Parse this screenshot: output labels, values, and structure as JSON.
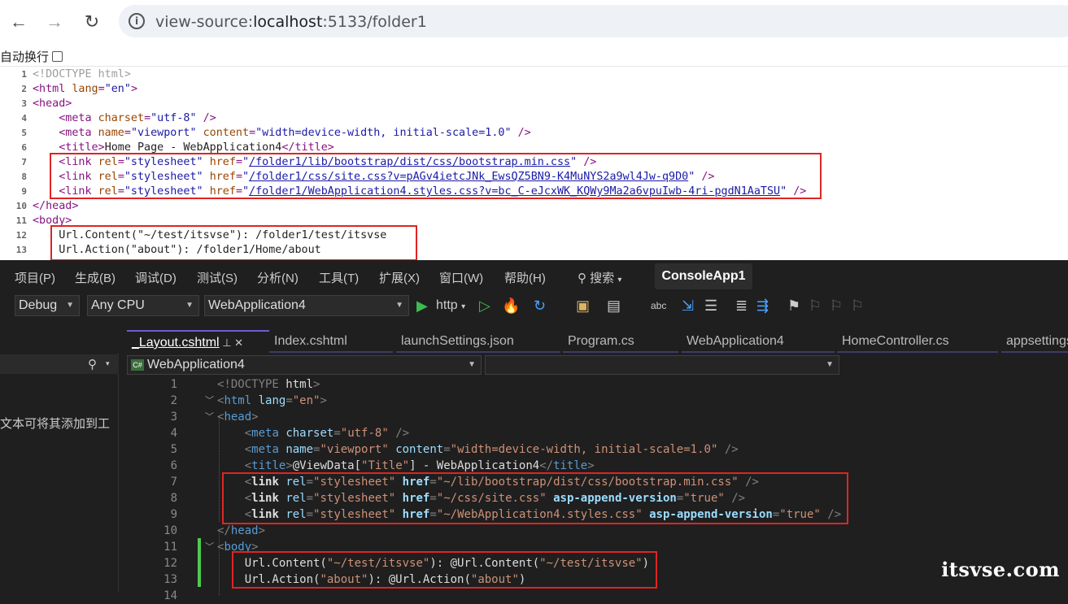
{
  "browser": {
    "url_prefix": "view-source:",
    "url_host": "localhost",
    "url_rest": ":5133/folder1",
    "wrap_label": "自动换行",
    "source_lines": [
      {
        "n": "1",
        "html": "<span class='sc'>&lt;!DOCTYPE html&gt;</span>"
      },
      {
        "n": "2",
        "html": "<span class='st'>&lt;html </span><span class='sa'>lang</span><span class='st'>=</span><span class='sv'>\"en\"</span><span class='st'>&gt;</span>"
      },
      {
        "n": "3",
        "html": "<span class='st'>&lt;head&gt;</span>"
      },
      {
        "n": "4",
        "html": "    <span class='st'>&lt;meta </span><span class='sa'>charset</span><span class='st'>=</span><span class='sv'>\"utf-8\"</span><span class='st'> /&gt;</span>"
      },
      {
        "n": "5",
        "html": "    <span class='st'>&lt;meta </span><span class='sa'>name</span><span class='st'>=</span><span class='sv'>\"viewport\"</span> <span class='sa'>content</span><span class='st'>=</span><span class='sv'>\"width=device-width, initial-scale=1.0\"</span><span class='st'> /&gt;</span>"
      },
      {
        "n": "6",
        "html": "    <span class='st'>&lt;title&gt;</span>Home Page - WebApplication4<span class='st'>&lt;/title&gt;</span>"
      },
      {
        "n": "7",
        "html": "    <span class='st'>&lt;link </span><span class='sa'>rel</span><span class='st'>=</span><span class='sv'>\"stylesheet\"</span> <span class='sa'>href</span><span class='st'>=</span><span class='sv'>\"</span><span class='sl'>/folder1/lib/bootstrap/dist/css/bootstrap.min.css</span><span class='sv'>\"</span><span class='st'> /&gt;</span>"
      },
      {
        "n": "8",
        "html": "    <span class='st'>&lt;link </span><span class='sa'>rel</span><span class='st'>=</span><span class='sv'>\"stylesheet\"</span> <span class='sa'>href</span><span class='st'>=</span><span class='sv'>\"</span><span class='sl'>/folder1/css/site.css?v=pAGv4ietcJNk_EwsQZ5BN9-K4MuNYS2a9wl4Jw-q9D0</span><span class='sv'>\"</span><span class='st'> /&gt;</span>"
      },
      {
        "n": "9",
        "html": "    <span class='st'>&lt;link </span><span class='sa'>rel</span><span class='st'>=</span><span class='sv'>\"stylesheet\"</span> <span class='sa'>href</span><span class='st'>=</span><span class='sv'>\"</span><span class='sl'>/folder1/WebApplication4.styles.css?v=bc_C-eJcxWK_KQWy9Ma2a6vpuIwb-4ri-pgdN1AaTSU</span><span class='sv'>\"</span><span class='st'> /&gt;</span>"
      },
      {
        "n": "10",
        "html": "<span class='st'>&lt;/head&gt;</span>"
      },
      {
        "n": "11",
        "html": "<span class='st'>&lt;body&gt;</span>"
      },
      {
        "n": "12",
        "html": "    Url.Content(\"~/test/itsvse\"): /folder1/test/itsvse"
      },
      {
        "n": "13",
        "html": "    Url.Action(\"about\"): /folder1/Home/about"
      }
    ]
  },
  "vs": {
    "menu": [
      "项目(P)",
      "生成(B)",
      "调试(D)",
      "测试(S)",
      "分析(N)",
      "工具(T)",
      "扩展(X)",
      "窗口(W)",
      "帮助(H)"
    ],
    "search_label": "搜索",
    "project_name": "ConsoleApp1",
    "config": "Debug",
    "platform": "Any CPU",
    "startup": "WebApplication4",
    "run_label": "http",
    "tabs": [
      "_Layout.cshtml",
      "Index.cshtml",
      "launchSettings.json",
      "Program.cs",
      "WebApplication4",
      "HomeController.cs",
      "appsettings"
    ],
    "nav_project": "WebApplication4",
    "left_hint": "文本可将其添加到工",
    "code_lines": [
      {
        "n": "1",
        "f": "",
        "html": "<span class='et'>&lt;!DOCTYPE </span><span class='eb'>html</span><span class='et'>&gt;</span>"
      },
      {
        "n": "2",
        "f": "v",
        "html": "<span class='et'>&lt;</span><span class='en'>html</span> <span class='ea'>lang</span><span class='et'>=</span><span class='ev'>\"en\"</span><span class='et'>&gt;</span>"
      },
      {
        "n": "3",
        "f": "v",
        "html": "<span class='et'>&lt;</span><span class='en'>head</span><span class='et'>&gt;</span>"
      },
      {
        "n": "4",
        "f": "",
        "html": "    <span class='et'>&lt;</span><span class='en'>meta</span> <span class='ea'>charset</span><span class='et'>=</span><span class='ev'>\"utf-8\"</span><span class='et'> /&gt;</span>"
      },
      {
        "n": "5",
        "f": "",
        "html": "    <span class='et'>&lt;</span><span class='en'>meta</span> <span class='ea'>name</span><span class='et'>=</span><span class='ev'>\"viewport\"</span> <span class='ea'>content</span><span class='et'>=</span><span class='ev'>\"width=device-width, initial-scale=1.0\"</span><span class='et'> /&gt;</span>"
      },
      {
        "n": "6",
        "f": "",
        "html": "    <span class='et'>&lt;</span><span class='en'>title</span><span class='et'>&gt;</span><span class='eb'>@ViewData[</span><span class='ev'>\"Title\"</span><span class='eb'>] - WebApplication4</span><span class='et'>&lt;/</span><span class='en'>title</span><span class='et'>&gt;</span>"
      },
      {
        "n": "7",
        "f": "",
        "html": "    <span class='et'>&lt;</span><span class='ebold'><b>link</b></span> <span class='ea'>rel</span><span class='et'>=</span><span class='ev'>\"stylesheet\"</span> <span class='ea'><b>href</b></span><span class='et'>=</span><span class='ev'>\"~/lib/bootstrap/dist/css/bootstrap.min.css\"</span><span class='et'> /&gt;</span>"
      },
      {
        "n": "8",
        "f": "",
        "html": "    <span class='et'>&lt;</span><span class='ebold'><b>link</b></span> <span class='ea'>rel</span><span class='et'>=</span><span class='ev'>\"stylesheet\"</span> <span class='ea'><b>href</b></span><span class='et'>=</span><span class='ev'>\"~/css/site.css\"</span> <span class='ea'><b>asp-append-version</b></span><span class='et'>=</span><span class='ev'>\"true\"</span><span class='et'> /&gt;</span>"
      },
      {
        "n": "9",
        "f": "",
        "html": "    <span class='et'>&lt;</span><span class='ebold'><b>link</b></span> <span class='ea'>rel</span><span class='et'>=</span><span class='ev'>\"stylesheet\"</span> <span class='ea'><b>href</b></span><span class='et'>=</span><span class='ev'>\"~/WebApplication4.styles.css\"</span> <span class='ea'><b>asp-append-version</b></span><span class='et'>=</span><span class='ev'>\"true\"</span><span class='et'> /&gt;</span>"
      },
      {
        "n": "10",
        "f": "",
        "html": "<span class='et'>&lt;/</span><span class='en'>head</span><span class='et'>&gt;</span>"
      },
      {
        "n": "11",
        "f": "v",
        "html": "<span class='et'>&lt;</span><span class='en'>body</span><span class='et'>&gt;</span>"
      },
      {
        "n": "12",
        "f": "",
        "html": "    <span class='eb'>Url.Content(</span><span class='ev'>\"~/test/itsvse\"</span><span class='eb'>): @Url.Content(</span><span class='ev'>\"~/test/itsvse\"</span><span class='eb'>)</span>"
      },
      {
        "n": "13",
        "f": "",
        "html": "    <span class='eb'>Url.Action(</span><span class='ev'>\"about\"</span><span class='eb'>): @Url.Action(</span><span class='ev'>\"about\"</span><span class='eb'>)</span>"
      },
      {
        "n": "14",
        "f": "",
        "html": ""
      }
    ]
  },
  "watermark": "itsvse.com"
}
